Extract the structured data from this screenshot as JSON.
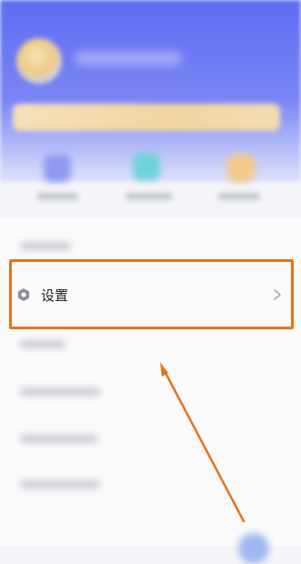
{
  "settings_item": {
    "label": "设置",
    "icon": "gear-icon",
    "chevron": "chevron-right-icon"
  },
  "colors": {
    "header_blue": "#5f6cf2",
    "highlight": "#e8721a",
    "arrow": "#e8721a"
  }
}
